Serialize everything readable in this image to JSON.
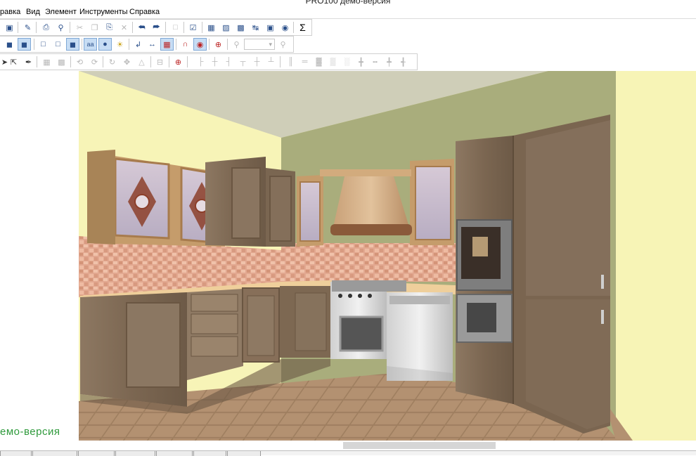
{
  "window": {
    "title": "PRO100 демо-версия"
  },
  "menu": {
    "items": [
      "равка",
      "Вид",
      "Элемент",
      "Инструменты",
      "Справка"
    ]
  },
  "icons": {
    "toolbar1": [
      "save-icon",
      "properties-icon",
      "print-icon",
      "print-preview-icon",
      "cut-icon",
      "copy-icon",
      "paste-icon",
      "delete-icon",
      "undo-icon",
      "redo-icon",
      "export-icon",
      "edit-icon",
      "library-icon",
      "catalog-icon",
      "elements-list-icon",
      "dimensions-icon",
      "render-icon",
      "price-icon",
      "sum-icon"
    ],
    "toolbar2": [
      "view-3d-icon",
      "view-box-icon",
      "wireframe-icon",
      "outline-icon",
      "solid-icon",
      "texture-icon",
      "shading-icon",
      "light-icon",
      "view-toggle-icon",
      "ruler-icon",
      "grid-icon",
      "magnet-icon",
      "snap-icon",
      "target-icon",
      "zoom-out-icon",
      "zoom-in-icon"
    ],
    "toolbar3": [
      "pointer-icon",
      "select-icon",
      "pen-icon",
      "group-icon",
      "ungroup-icon",
      "rotate-icon",
      "flip-icon",
      "rotate-90-icon",
      "move-icon",
      "mirror-icon",
      "mount-icon",
      "stop-icon"
    ]
  },
  "viewport": {
    "watermark": "емо-версия"
  },
  "colors": {
    "side_wall": "#f7f4b7",
    "back_wall": "#a9ad7c",
    "ceiling": "#cfceb8",
    "wood": "#7f6b55",
    "countertop": "#efcf9b",
    "accent_watermark": "#2f9a3c"
  }
}
